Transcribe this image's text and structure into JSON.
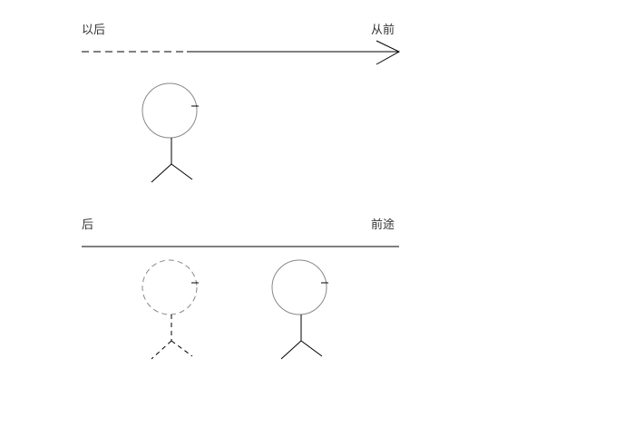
{
  "diagram": {
    "top_panel": {
      "left_label": "以后",
      "right_label": "从前"
    },
    "bottom_panel": {
      "left_label": "后",
      "right_label": "前途"
    }
  },
  "colors": {
    "line": "#000000",
    "head": "#888888",
    "text": "#333333"
  }
}
